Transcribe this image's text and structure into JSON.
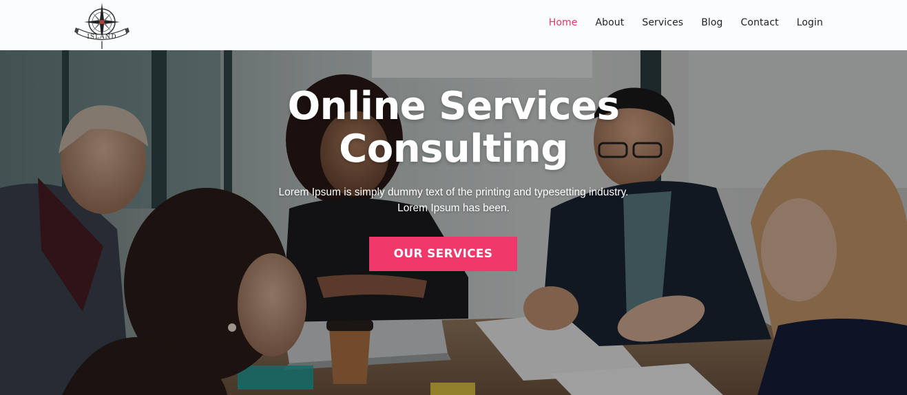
{
  "brand": {
    "logo_text": "ISLAND",
    "logo_icon": "compass-rose-icon"
  },
  "nav": {
    "items": [
      {
        "label": "Home",
        "active": true
      },
      {
        "label": "About",
        "active": false
      },
      {
        "label": "Services",
        "active": false
      },
      {
        "label": "Blog",
        "active": false
      },
      {
        "label": "Contact",
        "active": false
      },
      {
        "label": "Login",
        "active": false
      }
    ]
  },
  "hero": {
    "title_line1": "Online Services",
    "title_line2": "Consulting",
    "subtitle_line1": "Lorem Ipsum is simply dummy text of the printing and typesetting industry.",
    "subtitle_line2": "Lorem Ipsum has been.",
    "cta_label": "OUR SERVICES",
    "background_image": "business-meeting-photo"
  },
  "colors": {
    "accent": "#f0386a",
    "nav_active": "#e8365d",
    "nav_text": "#222222",
    "header_bg": "#fbfcfe"
  }
}
